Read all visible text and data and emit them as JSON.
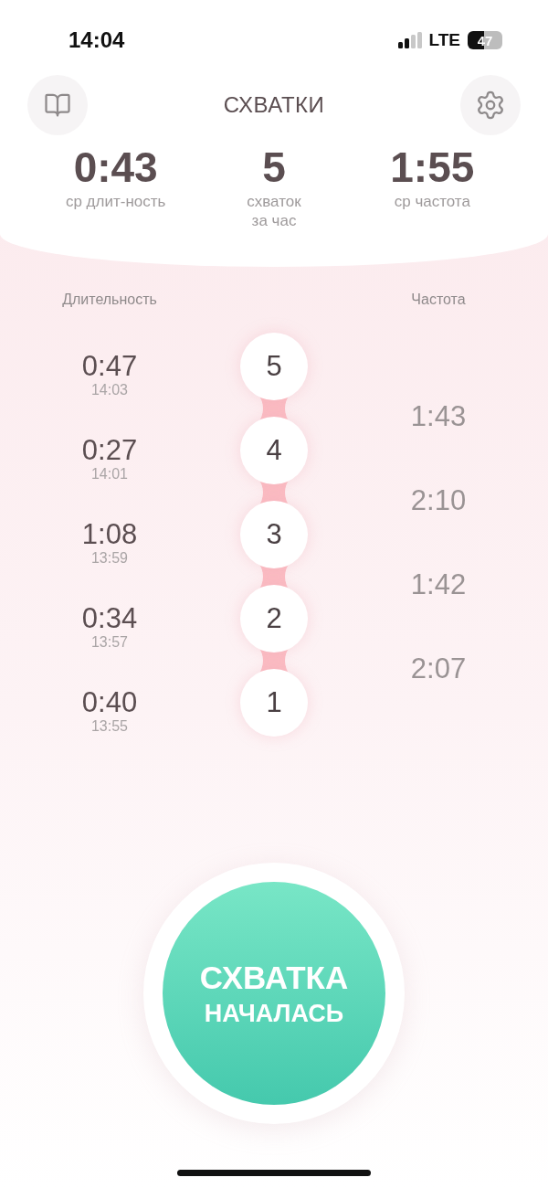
{
  "status_bar": {
    "time": "14:04",
    "network": "LTE",
    "battery": "47"
  },
  "header": {
    "title": "СХВАТКИ"
  },
  "stats": [
    {
      "value": "0:43",
      "label": "ср длит-ность"
    },
    {
      "value": "5",
      "label": "схваток\nза час"
    },
    {
      "value": "1:55",
      "label": "ср частота"
    }
  ],
  "columns": {
    "duration": "Длительность",
    "frequency": "Частота"
  },
  "contractions": [
    {
      "number": "5",
      "duration": "0:47",
      "start": "14:03"
    },
    {
      "number": "4",
      "duration": "0:27",
      "start": "14:01"
    },
    {
      "number": "3",
      "duration": "1:08",
      "start": "13:59"
    },
    {
      "number": "2",
      "duration": "0:34",
      "start": "13:57"
    },
    {
      "number": "1",
      "duration": "0:40",
      "start": "13:55"
    }
  ],
  "intervals": [
    "1:43",
    "2:10",
    "1:42",
    "2:07"
  ],
  "start_button": {
    "line1": "СХВАТКА",
    "line2": "НАЧАЛАСЬ"
  }
}
